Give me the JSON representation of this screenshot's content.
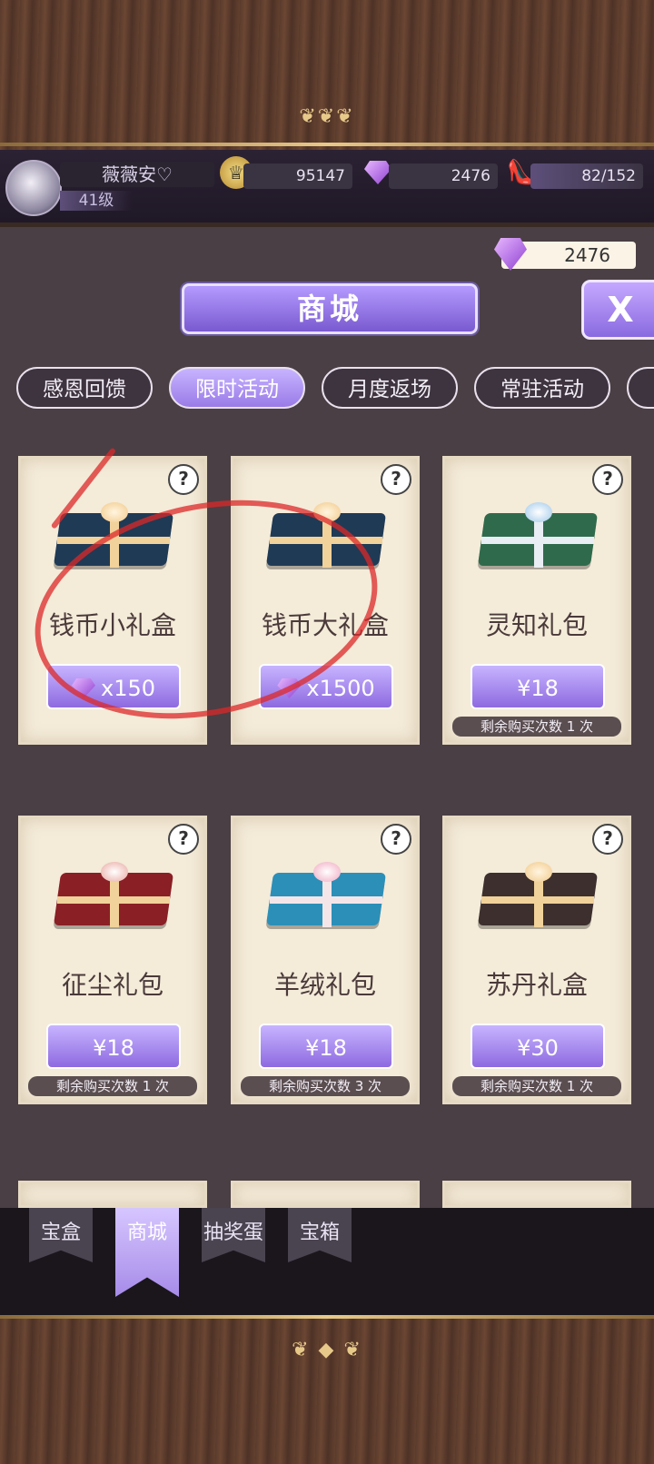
{
  "player": {
    "name": "薇薇安♡",
    "level": "41级"
  },
  "resources": {
    "coins": "95147",
    "diamonds": "2476",
    "stamina": "82/152"
  },
  "shop_diamonds": "2476",
  "title": "商城",
  "close_label": "X",
  "tabs": [
    {
      "label": "感恩回馈"
    },
    {
      "label": "限时活动"
    },
    {
      "label": "月度返场"
    },
    {
      "label": "常驻活动"
    }
  ],
  "active_tab": "限时活动",
  "items": [
    {
      "name": "钱币小礼盒",
      "price": "x150",
      "currency": "diamond",
      "color": "#1f3a55"
    },
    {
      "name": "钱币大礼盒",
      "price": "x1500",
      "currency": "diamond",
      "color": "#1f3a55"
    },
    {
      "name": "灵知礼包",
      "price": "¥18",
      "remaining": "剩余购买次数 1 次",
      "color": "#2f6a4c"
    },
    {
      "name": "征尘礼包",
      "price": "¥18",
      "remaining": "剩余购买次数 1 次",
      "color": "#8a1f25"
    },
    {
      "name": "羊绒礼包",
      "price": "¥18",
      "remaining": "剩余购买次数 3 次",
      "color": "#2c8fb8"
    },
    {
      "name": "苏丹礼盒",
      "price": "¥30",
      "remaining": "剩余购买次数 1 次",
      "color": "#3d2f2e"
    }
  ],
  "help_label": "?",
  "bottom_nav": [
    {
      "label": "宝盒"
    },
    {
      "label": "商城"
    },
    {
      "label": "抽奖蛋"
    },
    {
      "label": "宝箱"
    }
  ],
  "active_nav": "商城",
  "colors": {
    "accent": "#9a7be8",
    "annotation": "#dc2828"
  }
}
